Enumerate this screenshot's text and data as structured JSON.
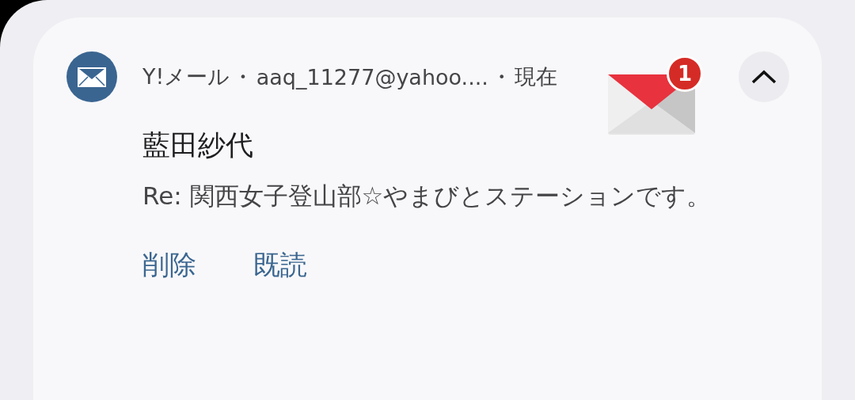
{
  "notification": {
    "header": [
      {
        "kind": "app",
        "text": "Y!メール"
      },
      {
        "kind": "dot",
        "text": "•"
      },
      {
        "kind": "account",
        "text": "aaq_11277@yahoo...."
      },
      {
        "kind": "dot",
        "text": "•"
      },
      {
        "kind": "time",
        "text": "現在"
      }
    ],
    "badge": "1",
    "expanded": true,
    "sender": "藍田紗代",
    "body": "Re: 関西女子登山部☆やまびとステーションです。",
    "actions": [
      "削除",
      "既読"
    ]
  }
}
